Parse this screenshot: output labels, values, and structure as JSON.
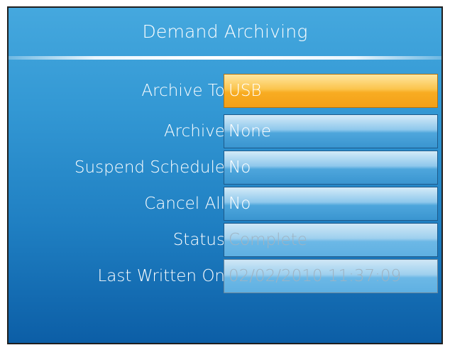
{
  "page": {
    "title": "Demand Archiving"
  },
  "colors": {
    "selected_field": "#fbb934",
    "field": "#5aace0",
    "background": "#2a8fd0"
  },
  "rows": [
    {
      "label": "Archive To",
      "value": "USB"
    },
    {
      "label": "Archive",
      "value": "None"
    },
    {
      "label": "Suspend Schedule",
      "value": "No"
    },
    {
      "label": "Cancel All",
      "value": "No"
    },
    {
      "label": "Status",
      "value": "Complete"
    },
    {
      "label": "Last Written On",
      "value": "02/02/2010 11:37:09"
    }
  ]
}
